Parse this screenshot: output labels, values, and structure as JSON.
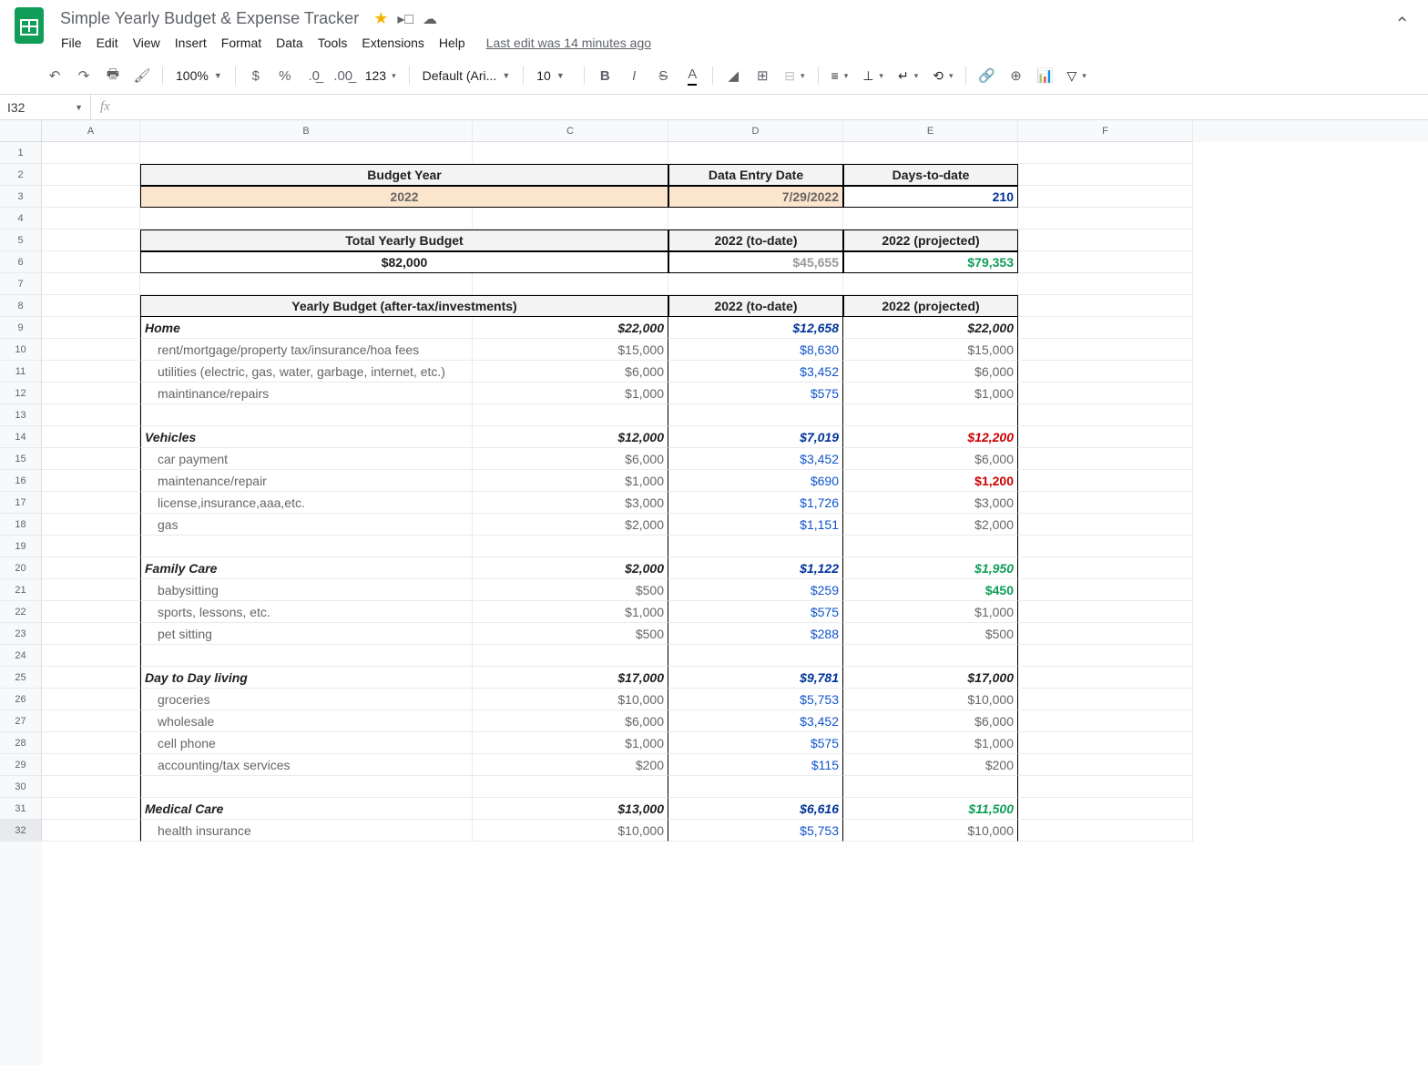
{
  "doc": {
    "title": "Simple Yearly Budget & Expense Tracker",
    "last_edit": "Last edit was 14 minutes ago"
  },
  "menus": [
    "File",
    "Edit",
    "View",
    "Insert",
    "Format",
    "Data",
    "Tools",
    "Extensions",
    "Help"
  ],
  "toolbar": {
    "zoom": "100%",
    "font": "Default (Ari...",
    "size": "10",
    "fmt": "123"
  },
  "namebox": "I32",
  "cols": [
    "A",
    "B",
    "C",
    "D",
    "E",
    "F"
  ],
  "rows": [
    "1",
    "2",
    "3",
    "4",
    "5",
    "6",
    "7",
    "8",
    "9",
    "10",
    "11",
    "12",
    "13",
    "14",
    "15",
    "16",
    "17",
    "18",
    "19",
    "20",
    "21",
    "22",
    "23",
    "24",
    "25",
    "26",
    "27",
    "28",
    "29",
    "30",
    "31",
    "32"
  ],
  "t1": {
    "h": [
      "Budget Year",
      "Data Entry Date",
      "Days-to-date"
    ],
    "v": [
      "2022",
      "7/29/2022",
      "210"
    ]
  },
  "t2": {
    "h": [
      "Total Yearly Budget",
      "2022 (to-date)",
      "2022 (projected)"
    ],
    "v": [
      "$82,000",
      "$45,655",
      "$79,353"
    ]
  },
  "t3": {
    "h": [
      "Yearly Budget (after-tax/investments)",
      "2022 (to-date)",
      "2022 (projected)"
    ]
  },
  "cat": [
    {
      "name": "Home",
      "b": "$22,000",
      "td": "$12,658",
      "p": "$22,000",
      "pc": "",
      "items": [
        {
          "n": "rent/mortgage/property tax/insurance/hoa fees",
          "b": "$15,000",
          "td": "$8,630",
          "p": "$15,000"
        },
        {
          "n": "utilities (electric, gas, water, garbage, internet, etc.)",
          "b": "$6,000",
          "td": "$3,452",
          "p": "$6,000"
        },
        {
          "n": "maintinance/repairs",
          "b": "$1,000",
          "td": "$575",
          "p": "$1,000"
        }
      ]
    },
    {
      "name": "Vehicles",
      "b": "$12,000",
      "td": "$7,019",
      "p": "$12,200",
      "pc": "red",
      "items": [
        {
          "n": "car payment",
          "b": "$6,000",
          "td": "$3,452",
          "p": "$6,000"
        },
        {
          "n": "maintenance/repair",
          "b": "$1,000",
          "td": "$690",
          "p": "$1,200",
          "pc": "red"
        },
        {
          "n": "license,insurance,aaa,etc.",
          "b": "$3,000",
          "td": "$1,726",
          "p": "$3,000"
        },
        {
          "n": "gas",
          "b": "$2,000",
          "td": "$1,151",
          "p": "$2,000"
        }
      ]
    },
    {
      "name": "Family Care",
      "b": "$2,000",
      "td": "$1,122",
      "p": "$1,950",
      "pc": "green",
      "items": [
        {
          "n": "babysitting",
          "b": "$500",
          "td": "$259",
          "p": "$450",
          "pc": "green"
        },
        {
          "n": "sports, lessons, etc.",
          "b": "$1,000",
          "td": "$575",
          "p": "$1,000"
        },
        {
          "n": "pet sitting",
          "b": "$500",
          "td": "$288",
          "p": "$500"
        }
      ]
    },
    {
      "name": "Day to Day living",
      "b": "$17,000",
      "td": "$9,781",
      "p": "$17,000",
      "pc": "",
      "items": [
        {
          "n": "groceries",
          "b": "$10,000",
          "td": "$5,753",
          "p": "$10,000"
        },
        {
          "n": "wholesale",
          "b": "$6,000",
          "td": "$3,452",
          "p": "$6,000"
        },
        {
          "n": "cell phone",
          "b": "$1,000",
          "td": "$575",
          "p": "$1,000"
        },
        {
          "n": "accounting/tax services",
          "b": "$200",
          "td": "$115",
          "p": "$200"
        }
      ]
    },
    {
      "name": "Medical Care",
      "b": "$13,000",
      "td": "$6,616",
      "p": "$11,500",
      "pc": "green",
      "items": [
        {
          "n": "health insurance",
          "b": "$10,000",
          "td": "$5,753",
          "p": "$10,000"
        }
      ]
    }
  ]
}
